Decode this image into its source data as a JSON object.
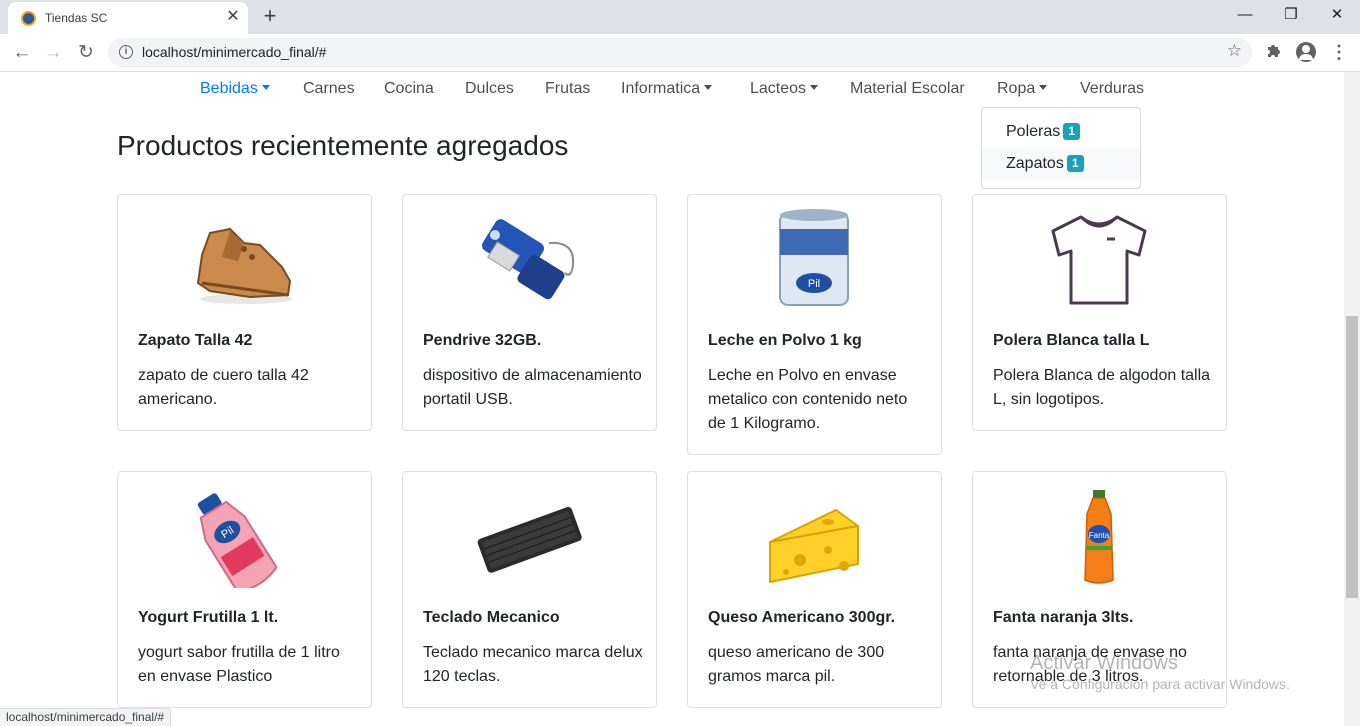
{
  "browser": {
    "tab_title": "Tiendas SC",
    "tab_close": "✕",
    "new_tab": "+",
    "url": "localhost/minimercado_final/#",
    "window_controls": {
      "minimize": "—",
      "restore": "❐",
      "close": "✕"
    },
    "status_url": "localhost/minimercado_final/#"
  },
  "navbar": {
    "items": [
      {
        "label": "Bebidas",
        "dropdown": true,
        "active": true
      },
      {
        "label": "Carnes",
        "dropdown": false
      },
      {
        "label": "Cocina",
        "dropdown": false
      },
      {
        "label": "Dulces",
        "dropdown": false
      },
      {
        "label": "Frutas",
        "dropdown": false
      },
      {
        "label": "Informatica",
        "dropdown": true
      },
      {
        "label": "Lacteos",
        "dropdown": true
      },
      {
        "label": "Material Escolar",
        "dropdown": false
      },
      {
        "label": "Ropa",
        "dropdown": true,
        "open": true
      },
      {
        "label": "Verduras",
        "dropdown": false
      }
    ],
    "ropa_menu": [
      {
        "label": "Poleras",
        "count": "1"
      },
      {
        "label": "Zapatos",
        "count": "1"
      }
    ]
  },
  "main": {
    "heading": "Productos recientemente agregados",
    "products": [
      {
        "name": "Zapato Talla 42",
        "description": "zapato de cuero talla 42 americano.",
        "icon": "shoe-icon"
      },
      {
        "name": "Pendrive 32GB.",
        "description": "dispositivo de almacenamiento portatil USB.",
        "icon": "usb-drive-icon"
      },
      {
        "name": "Leche en Polvo 1 kg",
        "description": "Leche en Polvo en envase metalico con contenido neto de 1 Kilogramo.",
        "icon": "milk-can-icon"
      },
      {
        "name": "Polera Blanca talla L",
        "description": "Polera Blanca de algodon talla L, sin logotipos.",
        "icon": "tshirt-icon"
      },
      {
        "name": "Yogurt Frutilla 1 lt.",
        "description": "yogurt sabor frutilla de 1 litro en envase Plastico",
        "icon": "yogurt-bottle-icon"
      },
      {
        "name": "Teclado Mecanico",
        "description": "Teclado mecanico marca delux 120 teclas.",
        "icon": "keyboard-icon"
      },
      {
        "name": "Queso Americano 300gr.",
        "description": "queso americano de 300 gramos marca pil.",
        "icon": "cheese-icon"
      },
      {
        "name": "Fanta naranja 3lts.",
        "description": "fanta naranja de envase no retornable de 3 litros.",
        "icon": "soda-bottle-icon"
      }
    ]
  },
  "watermark": {
    "title": "Activar Windows",
    "subtitle": "Ve a Configuración para activar Windows."
  },
  "colors": {
    "link_active": "#007bff",
    "badge": "#17a2b8"
  }
}
